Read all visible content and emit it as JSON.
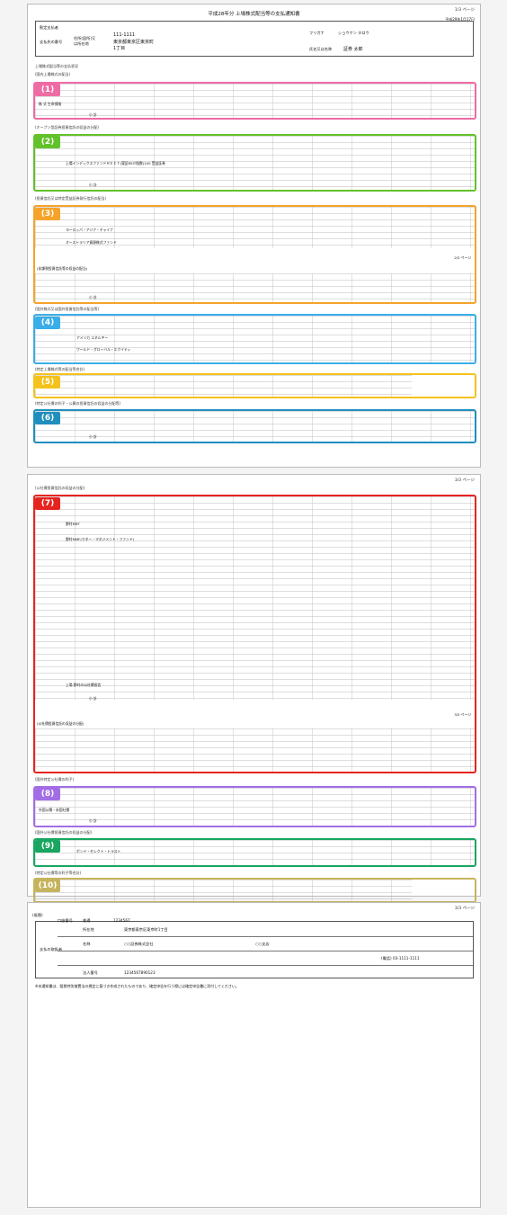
{
  "doc": {
    "title": "平成28年分 上場株式配当等の支払通知書",
    "date": "平成29年1月17日",
    "page1": "1/3 ページ",
    "page2": "2/3 ページ",
    "page3": "3/3 ページ",
    "page4": "3/3 ページ",
    "page5": "3/3 ページ"
  },
  "header": {
    "addressee_label": "勘定支払者",
    "postal": "111-1111",
    "address1": "東京都東京区東京町",
    "address2": "1丁目",
    "kana": "ショウケン タロウ",
    "name": "証券 太郎",
    "pid_label": "住所(居所)又は所在地",
    "furigana_label": "フリガナ",
    "name_label": "氏名又は名称",
    "member_label": "支払先の番号"
  },
  "labels": {
    "s_intro": "上場株式配当等の支払状況",
    "s1": "(国内上場株式の配当)",
    "s2": "(オープン型証券投資信託の収益の分配)",
    "s3": "(投資信託又は特定受益証券発行信託の配当)",
    "s3b": "(非課税投資信託等の収益の配当)",
    "s4": "(国外株式又は国外投資信託等の配当等)",
    "s5": "(特定上場株式等の配当等合計)",
    "s6": "(特定公社債の利子・公募の投資信託の収益の分配等)",
    "s7": "(公社債投資信託の収益の分配)",
    "s7b": "(公社債投資信託の収益の分配)",
    "s8": "(国外特定公社債の利子)",
    "s9": "(国外公社債投資信託の収益の分配)",
    "s10": "(特定公社債等の利子等合計)"
  },
  "badges": [
    "(1)",
    "(2)",
    "(3)",
    "(4)",
    "(5)",
    "(6)",
    "(7)",
    "(8)",
    "(9)",
    "(10)"
  ],
  "colors": {
    "b1": "#ee6ba4",
    "b2": "#62c22a",
    "b3": "#f5a32a",
    "b4": "#3aaee8",
    "b5": "#f4c21b",
    "b6": "#1f8fbd",
    "b7": "#e52420",
    "b8": "#a36ee5",
    "b9": "#19a661",
    "b10": "#c5b45d"
  },
  "rows": {
    "r1": "株 式  生命保険",
    "r2a": "上場インデックスファンドＲＥＩＴ(東証REIT指数)100 受益証券",
    "r3a": "ヨーロッパ・アジア・チャイナ",
    "r3b": "オーストラリア資源株式ファンド",
    "r4a": "アメリカ エネルギー",
    "r4b": "ワールド・グローバル・エクイティ",
    "r7a": "野村MRF",
    "r7b": "野村MMF(マネー・マネジメント・ファンド)",
    "r7c": "上場 野村の公社債投信",
    "r8a": "外国公債・米国社債",
    "r9a": "ボンド・セレクト・トラスト",
    "total": "小 計"
  },
  "bank": {
    "label": "(振替)",
    "code_label": "口座番号",
    "code": "普通",
    "number": "1234567",
    "name_label": "名称",
    "addr_label": "所在地",
    "addr": "東京都東京区東京町1丁目",
    "company": "○○証券株式会社",
    "branch": "○○支店",
    "tel": "(電話) 03-1111-1111",
    "corp_label": "法人番号",
    "corp": "1234567890123",
    "payer_label": "支払の取扱者"
  },
  "footnote": "※本通知書は、租税特別措置法の規定に基づき作成されたものであり、確定申告を行う際には確定申告書に添付してください。"
}
